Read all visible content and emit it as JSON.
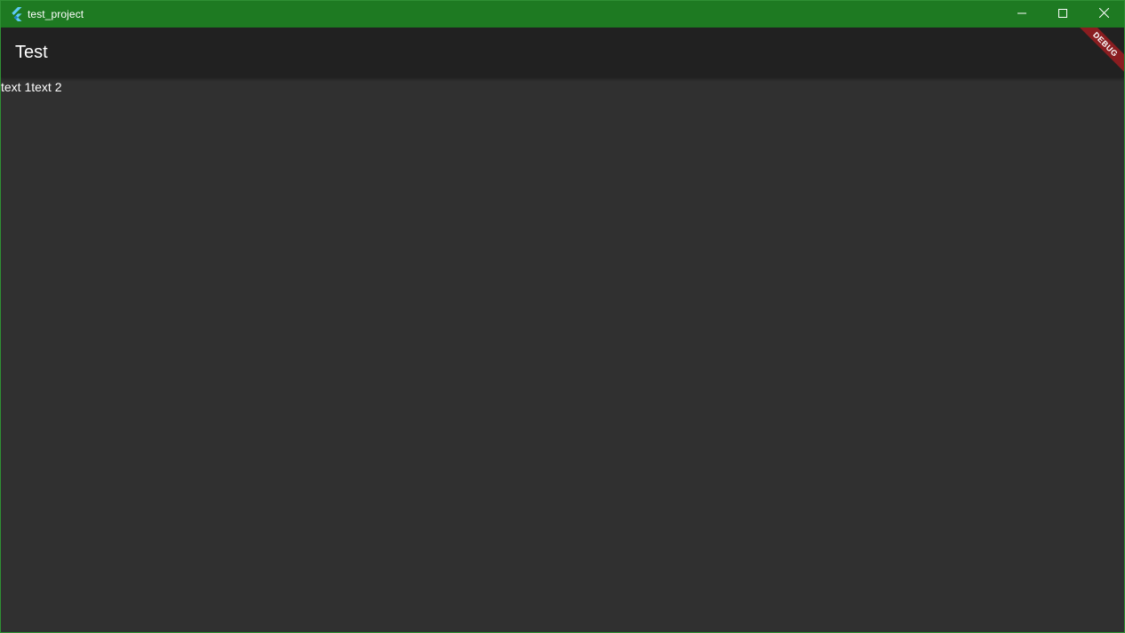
{
  "window": {
    "title": "test_project",
    "app_icon": "flutter-logo-icon",
    "controls": {
      "minimize_icon": "minimize-icon",
      "maximize_icon": "maximize-icon",
      "close_icon": "close-icon"
    },
    "titlebar_color": "#1e7a22"
  },
  "appbar": {
    "title": "Test",
    "background": "#212121"
  },
  "debug_banner": {
    "label": "DEBUG",
    "color": "#8a1d20"
  },
  "content": {
    "background": "#303030",
    "texts": [
      "text 1",
      "text 2"
    ]
  }
}
